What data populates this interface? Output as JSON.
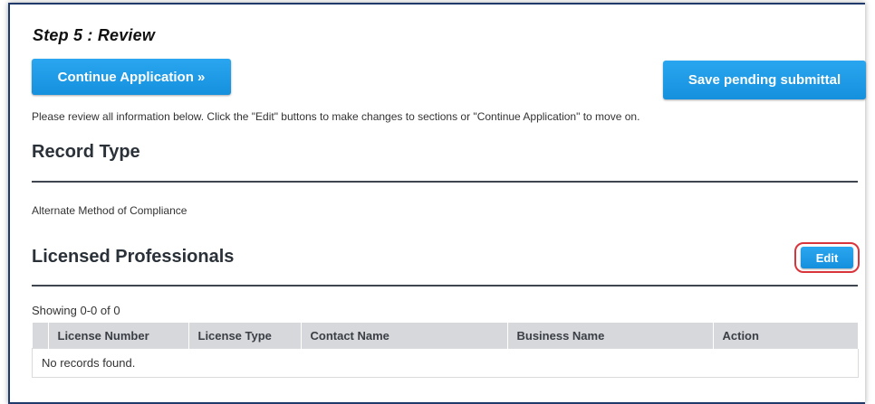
{
  "step_title": "Step 5 : Review",
  "buttons": {
    "continue_label": "Continue Application »",
    "save_label": "Save pending submittal",
    "edit_label": "Edit"
  },
  "intro_text": "Please review all information below. Click the \"Edit\" buttons to make changes to sections or \"Continue Application\" to move on.",
  "record_type": {
    "heading": "Record Type",
    "value": "Alternate Method of Compliance"
  },
  "licensed_professionals": {
    "heading": "Licensed Professionals",
    "showing": "Showing 0-0 of 0",
    "columns": [
      "",
      "License Number",
      "License Type",
      "Contact Name",
      "Business Name",
      "Action"
    ],
    "empty_message": "No records found."
  },
  "colors": {
    "button_blue": "#1e9be8",
    "highlight_red": "#d9343b",
    "border_navy": "#1f3a6b"
  }
}
